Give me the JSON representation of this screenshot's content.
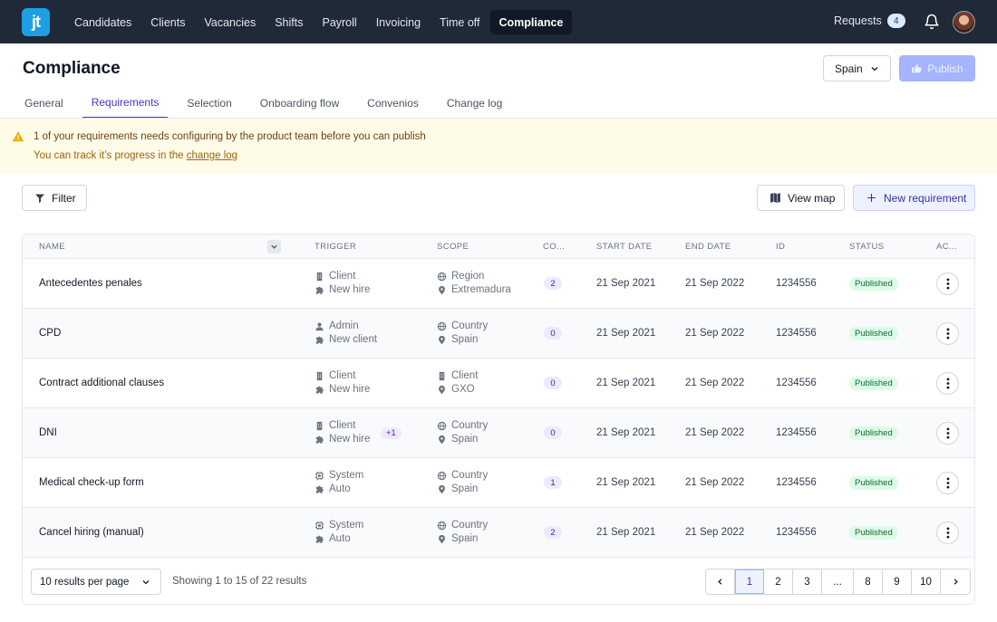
{
  "nav": {
    "logo": "jt",
    "items": [
      {
        "label": "Candidates",
        "active": false
      },
      {
        "label": "Clients",
        "active": false
      },
      {
        "label": "Vacancies",
        "active": false
      },
      {
        "label": "Shifts",
        "active": false
      },
      {
        "label": "Payroll",
        "active": false
      },
      {
        "label": "Invoicing",
        "active": false
      },
      {
        "label": "Time off",
        "active": false
      },
      {
        "label": "Compliance",
        "active": true
      }
    ],
    "requests_label": "Requests",
    "requests_count": "4"
  },
  "header": {
    "title": "Compliance",
    "country": "Spain",
    "publish_label": "Publish"
  },
  "tabs": [
    {
      "label": "General",
      "active": false
    },
    {
      "label": "Requirements",
      "active": true
    },
    {
      "label": "Selection",
      "active": false
    },
    {
      "label": "Onboarding flow",
      "active": false
    },
    {
      "label": "Convenios",
      "active": false
    },
    {
      "label": "Change log",
      "active": false
    }
  ],
  "banner": {
    "title": "1 of your requirements needs configuring by the product team before you can publish",
    "sub_prefix": "You can track it’s progress in the ",
    "sub_link": "change log"
  },
  "toolbar": {
    "filter_label": "Filter",
    "view_map_label": "View map",
    "new_requirement_label": "New requirement"
  },
  "table": {
    "columns": {
      "name": "Name",
      "trigger": "Trigger",
      "scope": "Scope",
      "count": "Co...",
      "start_date": "Start date",
      "end_date": "End date",
      "id": "ID",
      "status": "Status",
      "actions": "Ac..."
    },
    "rows": [
      {
        "name": "Antecedentes penales",
        "trigger_a": "Client",
        "trigger_a_icon": "building-icon",
        "trigger_b": "New hire",
        "trigger_extra": "",
        "scope_a": "Region",
        "scope_a_icon": "globe-icon",
        "scope_b": "Extremadura",
        "count": "2",
        "start": "21 Sep 2021",
        "end": "21 Sep 2022",
        "id": "1234556",
        "status": "Published"
      },
      {
        "name": "CPD",
        "trigger_a": "Admin",
        "trigger_a_icon": "user-icon",
        "trigger_b": "New client",
        "trigger_extra": "",
        "scope_a": "Country",
        "scope_a_icon": "globe-icon",
        "scope_b": "Spain",
        "count": "0",
        "start": "21 Sep 2021",
        "end": "21 Sep 2022",
        "id": "1234556",
        "status": "Published"
      },
      {
        "name": "Contract additional clauses",
        "trigger_a": "Client",
        "trigger_a_icon": "building-icon",
        "trigger_b": "New hire",
        "trigger_extra": "",
        "scope_a": "Client",
        "scope_a_icon": "building-icon",
        "scope_b": "GXO",
        "count": "0",
        "start": "21 Sep 2021",
        "end": "21 Sep 2022",
        "id": "1234556",
        "status": "Published"
      },
      {
        "name": "DNI",
        "trigger_a": "Client",
        "trigger_a_icon": "building-icon",
        "trigger_b": "New hire",
        "trigger_extra": "+1",
        "scope_a": "Country",
        "scope_a_icon": "globe-icon",
        "scope_b": "Spain",
        "count": "0",
        "start": "21 Sep 2021",
        "end": "21 Sep 2022",
        "id": "1234556",
        "status": "Published"
      },
      {
        "name": "Medical check-up form",
        "trigger_a": "System",
        "trigger_a_icon": "chip-icon",
        "trigger_b": "Auto",
        "trigger_extra": "",
        "scope_a": "Country",
        "scope_a_icon": "globe-icon",
        "scope_b": "Spain",
        "count": "1",
        "start": "21 Sep 2021",
        "end": "21 Sep 2022",
        "id": "1234556",
        "status": "Published"
      },
      {
        "name": "Cancel hiring (manual)",
        "trigger_a": "System",
        "trigger_a_icon": "chip-icon",
        "trigger_b": "Auto",
        "trigger_extra": "",
        "scope_a": "Country",
        "scope_a_icon": "globe-icon",
        "scope_b": "Spain",
        "count": "2",
        "start": "21 Sep 2021",
        "end": "21 Sep 2022",
        "id": "1234556",
        "status": "Published"
      }
    ]
  },
  "footer": {
    "per_page": "10 results per page",
    "showing": "Showing 1 to 15 of 22 results",
    "pages": [
      "1",
      "2",
      "3",
      "...",
      "8",
      "9",
      "10"
    ],
    "current_page": "1"
  }
}
